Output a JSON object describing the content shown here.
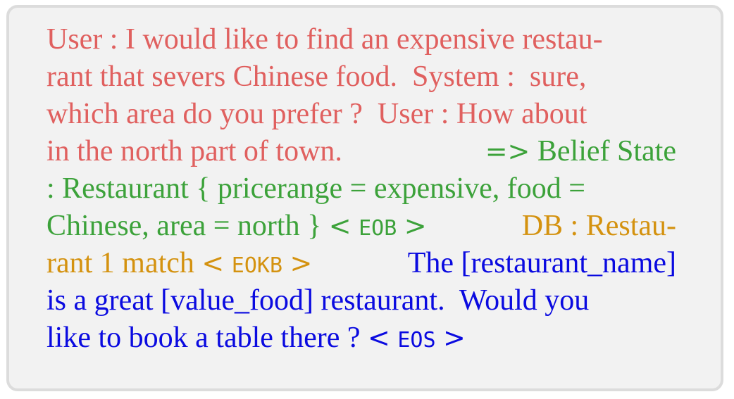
{
  "colors": {
    "user_context": "#e0605f",
    "belief_state": "#3ca23a",
    "db": "#d4920f",
    "response": "#0a0ae0",
    "box_background": "#f2f2f2",
    "box_border": "#dcdcdc"
  },
  "example": {
    "lines": [
      [
        {
          "role": "user_context",
          "text": "User : I would like to find an expensive restau-"
        }
      ],
      [
        {
          "role": "user_context",
          "text": "rant that severs Chinese food.  System :  sure,"
        }
      ],
      [
        {
          "role": "user_context",
          "text": "which area do you prefer ?  User : How about"
        }
      ],
      [
        {
          "role": "user_context",
          "text": "in the north part of town."
        },
        {
          "role": "belief_state",
          "text": "=> Belief State"
        }
      ],
      [
        {
          "role": "belief_state",
          "text": ": Restaurant { pricerange = expensive, food ="
        }
      ],
      [
        {
          "role": "belief_state",
          "text": "Chinese, area = north } < EOB >"
        },
        {
          "role": "db",
          "text": "DB : Restau-"
        }
      ],
      [
        {
          "role": "db",
          "text": "rant 1 match < EOKB >"
        },
        {
          "role": "response",
          "text": "The [restaurant_name]"
        }
      ],
      [
        {
          "role": "response",
          "text": "is a great [value_food] restaurant.  Would you"
        }
      ],
      [
        {
          "role": "response",
          "text": "like to book a table there ? < EOS >"
        }
      ]
    ]
  }
}
